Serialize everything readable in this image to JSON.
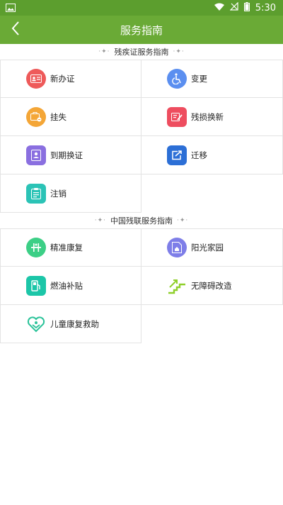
{
  "status_bar": {
    "time": "5:30"
  },
  "header": {
    "title": "服务指南"
  },
  "section1": {
    "title": "残疾证服务指南",
    "items": [
      {
        "label": "新办证",
        "color": "#ee5a5a",
        "icon": "id-card-icon"
      },
      {
        "label": "变更",
        "color": "#5b8ff0",
        "icon": "wheelchair-icon"
      },
      {
        "label": "挂失",
        "color": "#f4a637",
        "icon": "lost-card-icon"
      },
      {
        "label": "残损换新",
        "color": "#ee4d5f",
        "icon": "edit-card-icon"
      },
      {
        "label": "到期换证",
        "color": "#8a6fe0",
        "icon": "badge-icon"
      },
      {
        "label": "迁移",
        "color": "#2c6fd6",
        "icon": "transfer-icon"
      },
      {
        "label": "注销",
        "color": "#2bc3b6",
        "icon": "cancel-doc-icon"
      }
    ]
  },
  "section2": {
    "title": "中国残联服务指南",
    "items": [
      {
        "label": "精准康复",
        "color": "#3ccf86",
        "icon": "rehab-icon"
      },
      {
        "label": "阳光家园",
        "color": "#7e7ee8",
        "icon": "sunshine-home-icon"
      },
      {
        "label": "燃油补贴",
        "color": "#1cc6a8",
        "icon": "fuel-pump-icon"
      },
      {
        "label": "无障碍改造",
        "color": "#8fcf2a",
        "icon": "barrier-free-icon"
      },
      {
        "label": "儿童康复救助",
        "color": "#2cc39a",
        "icon": "child-heart-icon"
      }
    ]
  }
}
